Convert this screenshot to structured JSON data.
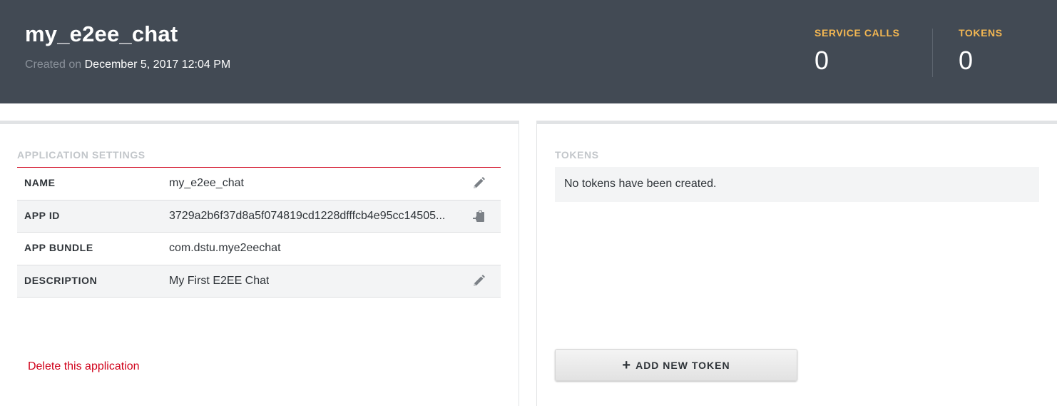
{
  "header": {
    "title": "my_e2ee_chat",
    "created_prefix": "Created on",
    "created_date": "December 5, 2017 12:04 PM",
    "stats": {
      "service_calls_label": "SERVICE CALLS",
      "service_calls_value": "0",
      "tokens_label": "TOKENS",
      "tokens_value": "0"
    }
  },
  "settings": {
    "title": "APPLICATION SETTINGS",
    "rows": [
      {
        "key": "NAME",
        "value": "my_e2ee_chat",
        "action_icon": "pencil-icon"
      },
      {
        "key": "APP ID",
        "value": "3729a2b6f37d8a5f074819cd1228dfffcb4e95cc14505...",
        "action_icon": "clipboard-icon"
      },
      {
        "key": "APP BUNDLE",
        "value": "com.dstu.mye2eechat"
      },
      {
        "key": "DESCRIPTION",
        "value": "My First E2EE Chat",
        "action_icon": "pencil-icon"
      }
    ],
    "delete_label": "Delete this application"
  },
  "tokens": {
    "title": "TOKENS",
    "empty_message": "No tokens have been created.",
    "add_button_icon": "plus-icon",
    "add_button_label": "ADD NEW TOKEN"
  },
  "colors": {
    "header_bg": "#424a54",
    "accent_orange": "#f2b652",
    "danger_red": "#d0021b"
  }
}
